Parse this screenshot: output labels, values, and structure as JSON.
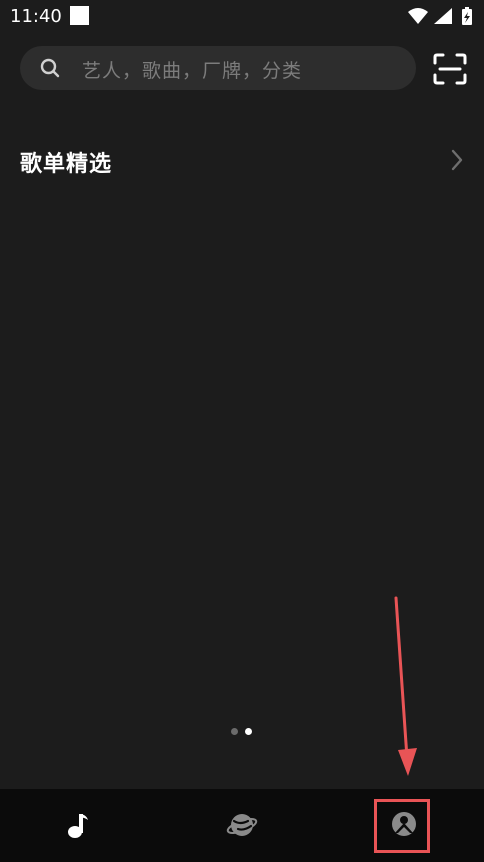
{
  "status_bar": {
    "time": "11:40"
  },
  "search": {
    "placeholder": "艺人，歌曲，厂牌，分类"
  },
  "section": {
    "title": "歌单精选"
  },
  "carousel": {
    "page_count": 2,
    "active_index": 1
  },
  "bottom_nav": {
    "items": [
      {
        "icon": "music-note-icon",
        "active": true
      },
      {
        "icon": "planet-icon",
        "active": false
      },
      {
        "icon": "profile-icon",
        "active": false
      }
    ]
  },
  "annotation": {
    "highlight_target": "profile-icon",
    "color": "#e95456"
  },
  "colors": {
    "background": "#1c1c1c",
    "search_bg": "#2d2d2d",
    "nav_bg": "#0b0b0b",
    "inactive_icon": "#8a8a8a",
    "accent_annotation": "#e95456"
  }
}
